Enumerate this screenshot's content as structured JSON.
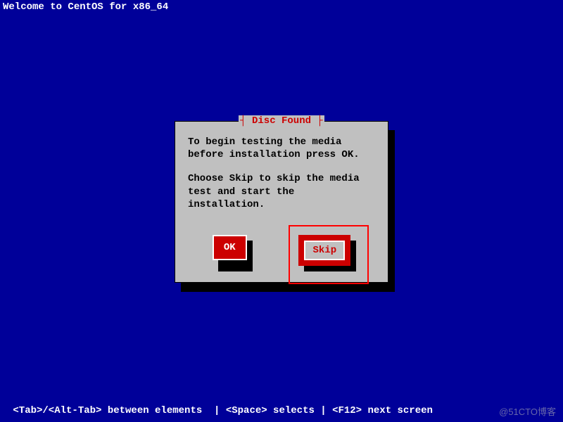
{
  "header": {
    "welcome_text": "Welcome to CentOS for x86_64"
  },
  "dialog": {
    "title": "┤ Disc Found ├",
    "message1": "To begin testing the media before installation press OK.",
    "message2": "Choose Skip to skip the media test and start the installation.",
    "ok_label": "OK",
    "skip_label": "Skip"
  },
  "footer": {
    "hint_text": " <Tab>/<Alt-Tab> between elements  | <Space> selects | <F12> next screen"
  },
  "watermark": "@51CTO博客"
}
